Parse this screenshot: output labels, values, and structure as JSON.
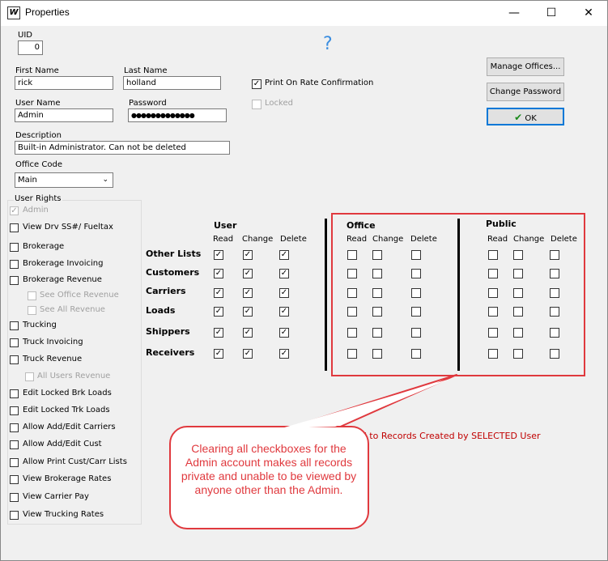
{
  "window": {
    "title": "Properties",
    "app_icon": "W",
    "minimize": "—",
    "maximize": "☐",
    "close": "✕"
  },
  "help_glyph": "?",
  "uid": {
    "label": "UID",
    "value": "0"
  },
  "first_name": {
    "label": "First Name",
    "value": "rick"
  },
  "last_name": {
    "label": "Last Name",
    "value": "holland"
  },
  "user_name": {
    "label": "User Name",
    "value": "Admin"
  },
  "password": {
    "label": "Password",
    "value": "●●●●●●●●●●●●●"
  },
  "description": {
    "label": "Description",
    "value": "Built-in Administrator. Can not be deleted"
  },
  "office_code": {
    "label": "Office Code",
    "value": "Main"
  },
  "print_on_rate": {
    "label": "Print On Rate Confirmation",
    "checked": true
  },
  "locked": {
    "label": "Locked",
    "checked": false
  },
  "buttons": {
    "manage_offices": "Manage Offices...",
    "change_password": "Change Password",
    "ok": "OK"
  },
  "user_rights": {
    "title": "User Rights",
    "items": [
      {
        "label": "Admin",
        "checked": true,
        "disabled": true
      },
      {
        "label": "View Drv SS#/ Fueltax"
      },
      {
        "label": "Brokerage"
      },
      {
        "label": "Brokerage Invoicing"
      },
      {
        "label": "Brokerage Revenue"
      },
      {
        "label": "See Office Revenue",
        "disabled": true
      },
      {
        "label": "See All Revenue",
        "disabled": true
      },
      {
        "label": "Trucking"
      },
      {
        "label": "Truck Invoicing"
      },
      {
        "label": "Truck Revenue"
      },
      {
        "label": "All Users Revenue",
        "disabled": true
      },
      {
        "label": "Edit Locked Brk Loads"
      },
      {
        "label": "Edit Locked Trk Loads"
      },
      {
        "label": "Allow Add/Edit Carriers"
      },
      {
        "label": "Allow Add/Edit Cust"
      },
      {
        "label": "Allow Print Cust/Carr Lists"
      },
      {
        "label": "View Brokerage Rates"
      },
      {
        "label": "View Carrier Pay"
      },
      {
        "label": "View Trucking Rates"
      }
    ]
  },
  "permissions": {
    "groups": [
      "User",
      "Office",
      "Public"
    ],
    "columns": [
      "Read",
      "Change",
      "Delete"
    ],
    "rows": [
      "Other Lists",
      "Customers",
      "Carriers",
      "Loads",
      "Shippers",
      "Receivers"
    ],
    "user_checked": true,
    "office_checked": false,
    "public_checked": false
  },
  "partial_red_text": "ied to Records Created by SELECTED User",
  "callout_text": "Clearing all checkboxes for the Admin account makes all records private and unable to be viewed by anyone other than the Admin.",
  "colors": {
    "highlight": "#e0393e",
    "accent_text": "#c00000",
    "callout_text": "#e0393e"
  }
}
